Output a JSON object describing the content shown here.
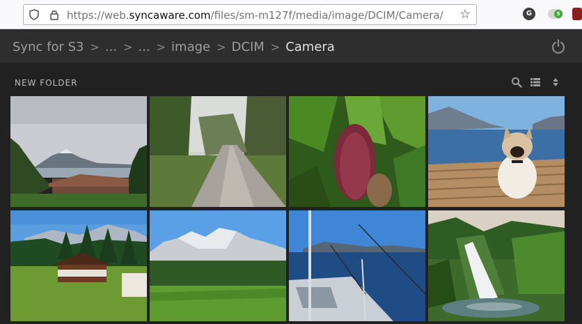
{
  "browser": {
    "url_prefix": "https://web.",
    "url_domain": "syncaware.com",
    "url_path": "/files/sm-m127f/media/image/DCIM/Camera/",
    "extensions": {
      "g_label": "G",
      "toggle_label": "5"
    }
  },
  "app": {
    "title": "Sync for S3",
    "breadcrumbs": [
      "...",
      "...",
      "image",
      "DCIM"
    ],
    "current_folder": "Camera",
    "separator": ">"
  },
  "toolbar": {
    "new_folder_label": "NEW FOLDER",
    "icons": [
      "search-icon",
      "list-view-icon",
      "sort-icon"
    ]
  },
  "gallery": {
    "photos": [
      {
        "subject": "lake-mountain-village"
      },
      {
        "subject": "gravel-path-forest"
      },
      {
        "subject": "banana-flower"
      },
      {
        "subject": "dog-on-dock"
      },
      {
        "subject": "alpine-chalet"
      },
      {
        "subject": "dolomites-meadow"
      },
      {
        "subject": "sailboat-deck"
      },
      {
        "subject": "waterfall-garden"
      }
    ]
  },
  "colors": {
    "background": "#212121",
    "header": "#2e2e2e",
    "crumb": "#9e9e9e",
    "crumb_current": "#e0e0e0"
  }
}
